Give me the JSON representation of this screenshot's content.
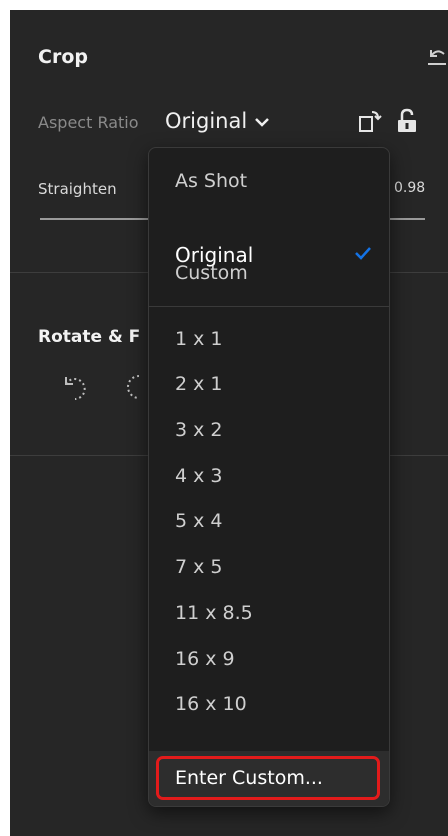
{
  "crop": {
    "title": "Crop",
    "aspect_label": "Aspect Ratio",
    "aspect_value": "Original",
    "straighten_label": "Straighten",
    "straighten_value": "0.98"
  },
  "rotate": {
    "title": "Rotate & F"
  },
  "dropdown": {
    "items": [
      "As Shot",
      "Original",
      "Custom",
      "1 x 1",
      "2 x 1",
      "3 x 2",
      "4 x 3",
      "5 x 4",
      "7 x 5",
      "11 x 8.5",
      "16 x 9",
      "16 x 10"
    ],
    "selected": "Original",
    "enter_custom": "Enter Custom..."
  },
  "colors": {
    "panel_bg": "#262626",
    "menu_bg": "#1e1e1e",
    "check": "#1473e6",
    "highlight_border": "#e21b1b"
  },
  "icons": [
    "reset-icon",
    "chevron-down-icon",
    "swap-orientation-icon",
    "lock-icon",
    "rotate-left-icon",
    "rotate-right-icon",
    "checkmark-icon"
  ]
}
